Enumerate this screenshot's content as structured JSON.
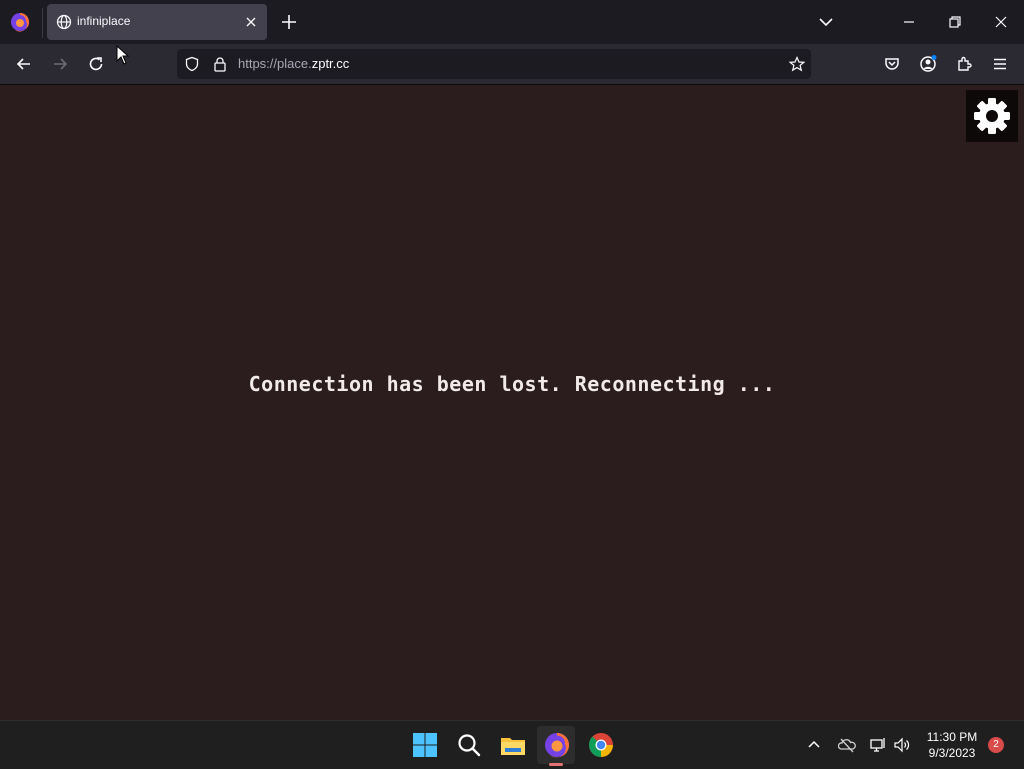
{
  "browser": {
    "tab": {
      "title": "infiniplace"
    },
    "url": {
      "prefix": "https://place.",
      "domain": "zptr.cc"
    }
  },
  "content": {
    "message": "Connection has been lost. Reconnecting ..."
  },
  "taskbar": {
    "time": "11:30 PM",
    "date": "9/3/2023",
    "notification_count": "2"
  },
  "colors": {
    "page_background": "#2b1d1d",
    "chrome_background": "#1c1b22",
    "navbar_background": "#2b2a33",
    "taskbar_background": "#1f1f1f"
  }
}
